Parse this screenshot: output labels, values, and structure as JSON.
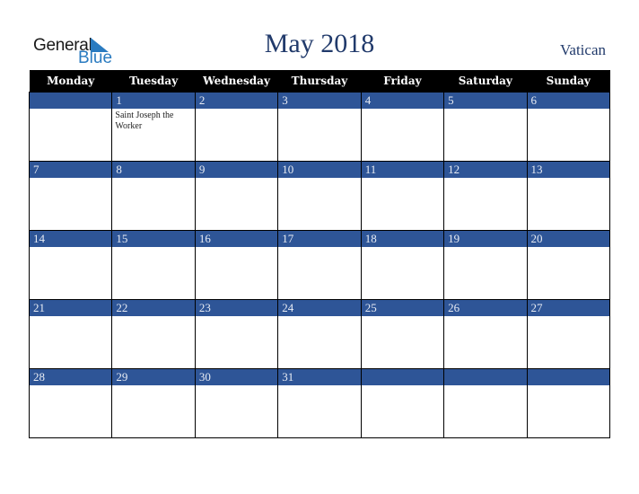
{
  "logo": {
    "word1": "General",
    "word2": "Blue"
  },
  "title": "May 2018",
  "country": "Vatican",
  "colors": {
    "header_bg": "#000000",
    "day_band": "#2e5597",
    "title": "#213a6b",
    "logo_blue": "#2a7bc0"
  },
  "weekdays": [
    "Monday",
    "Tuesday",
    "Wednesday",
    "Thursday",
    "Friday",
    "Saturday",
    "Sunday"
  ],
  "weeks": [
    [
      {
        "day": "",
        "event": ""
      },
      {
        "day": "1",
        "event": "Saint Joseph the Worker"
      },
      {
        "day": "2",
        "event": ""
      },
      {
        "day": "3",
        "event": ""
      },
      {
        "day": "4",
        "event": ""
      },
      {
        "day": "5",
        "event": ""
      },
      {
        "day": "6",
        "event": ""
      }
    ],
    [
      {
        "day": "7",
        "event": ""
      },
      {
        "day": "8",
        "event": ""
      },
      {
        "day": "9",
        "event": ""
      },
      {
        "day": "10",
        "event": ""
      },
      {
        "day": "11",
        "event": ""
      },
      {
        "day": "12",
        "event": ""
      },
      {
        "day": "13",
        "event": ""
      }
    ],
    [
      {
        "day": "14",
        "event": ""
      },
      {
        "day": "15",
        "event": ""
      },
      {
        "day": "16",
        "event": ""
      },
      {
        "day": "17",
        "event": ""
      },
      {
        "day": "18",
        "event": ""
      },
      {
        "day": "19",
        "event": ""
      },
      {
        "day": "20",
        "event": ""
      }
    ],
    [
      {
        "day": "21",
        "event": ""
      },
      {
        "day": "22",
        "event": ""
      },
      {
        "day": "23",
        "event": ""
      },
      {
        "day": "24",
        "event": ""
      },
      {
        "day": "25",
        "event": ""
      },
      {
        "day": "26",
        "event": ""
      },
      {
        "day": "27",
        "event": ""
      }
    ],
    [
      {
        "day": "28",
        "event": ""
      },
      {
        "day": "29",
        "event": ""
      },
      {
        "day": "30",
        "event": ""
      },
      {
        "day": "31",
        "event": ""
      },
      {
        "day": "",
        "event": ""
      },
      {
        "day": "",
        "event": ""
      },
      {
        "day": "",
        "event": ""
      }
    ]
  ]
}
